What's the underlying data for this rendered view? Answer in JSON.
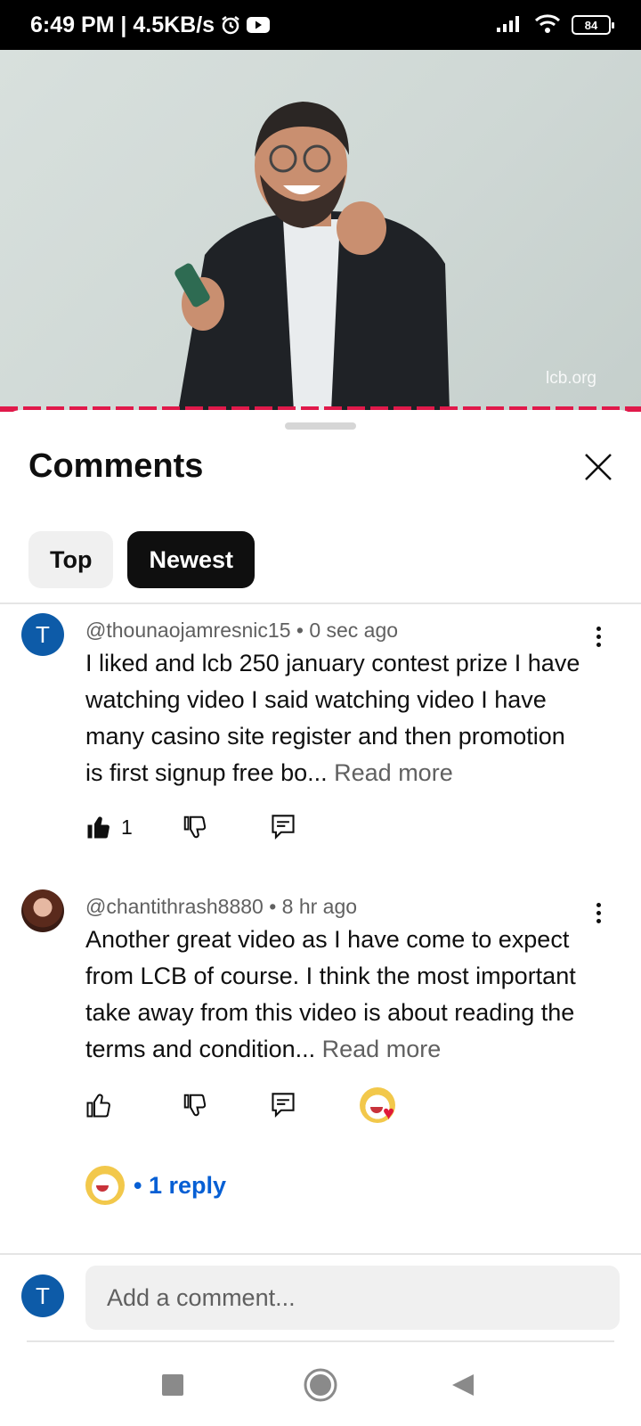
{
  "status_bar": {
    "time_speed": "6:49 PM | 4.5KB/s",
    "battery": "84"
  },
  "video": {
    "watermark": "lcb.org"
  },
  "comments_sheet": {
    "title": "Comments",
    "filters": [
      "Top",
      "Newest"
    ],
    "selected_filter": "Newest"
  },
  "comments": [
    {
      "avatar_letter": "T",
      "handle": "@thounaojamresnic15",
      "time": "• 0 sec ago",
      "text": "I liked and lcb 250 january contest prize I have watching video I said watching video I have many casino site register and then promotion is first signup free bo...",
      "read_more": "Read more",
      "likes": "1"
    },
    {
      "handle": "@chantithrash8880",
      "time": "• 8 hr ago",
      "text": "Another great video as I have come to expect from LCB of course. I think the most important take away from this video is about reading the terms and condition...",
      "read_more": "Read more",
      "replies": "• 1 reply"
    }
  ],
  "composer": {
    "avatar_letter": "T",
    "placeholder": "Add a comment..."
  },
  "colors": {
    "accent_progress": "#e0194a",
    "link_blue": "#065fd4",
    "avatar_blue": "#0d5ba8"
  }
}
